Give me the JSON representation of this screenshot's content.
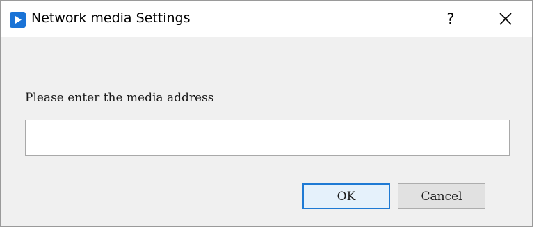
{
  "window": {
    "title": "Network media Settings",
    "help_label": "?",
    "icon": "media-player-app-icon"
  },
  "form": {
    "prompt": "Please enter the media address",
    "address_value": "",
    "address_placeholder": ""
  },
  "buttons": {
    "ok_label": "OK",
    "cancel_label": "Cancel"
  },
  "colors": {
    "app_icon": "#1a73d6",
    "ok_border": "#1e7ad4",
    "dialog_bg": "#f0f0f0"
  }
}
